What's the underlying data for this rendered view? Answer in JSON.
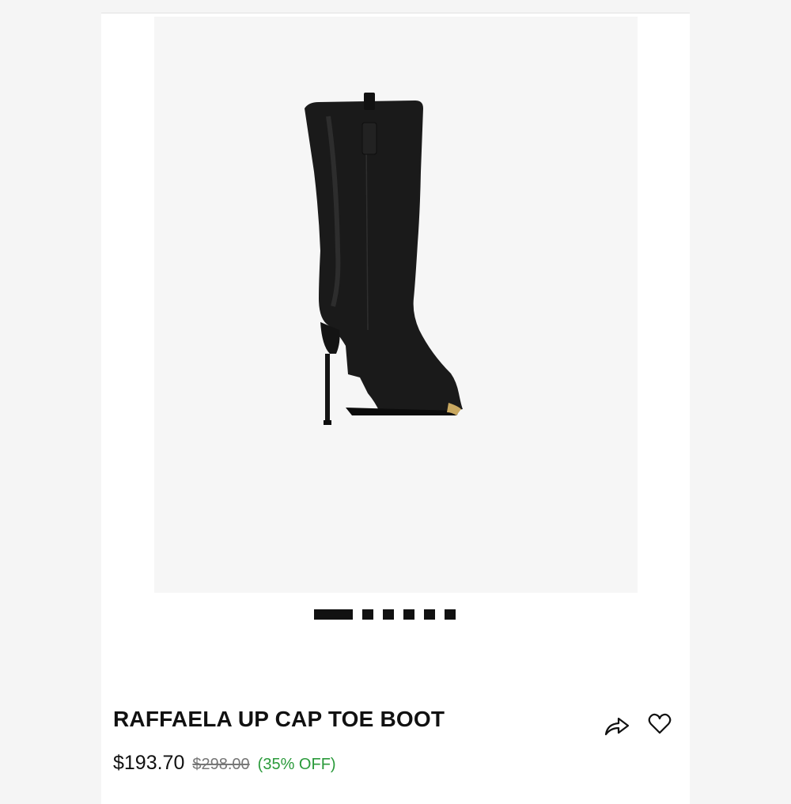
{
  "product": {
    "title": "RAFFAELA UP CAP TOE BOOT",
    "price": "$193.70",
    "original_price": "$298.00",
    "discount": "(35% OFF)"
  },
  "carousel": {
    "total_slides": 6,
    "active_index": 0
  },
  "icons": {
    "share": "share-arrow-icon",
    "favorite": "heart-outline-icon"
  },
  "colors": {
    "discount": "#2a9a3a",
    "text": "#111111",
    "image_bg": "#f6f6f6"
  }
}
